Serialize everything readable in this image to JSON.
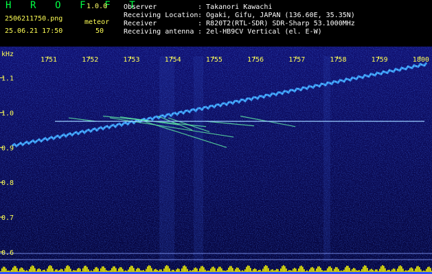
{
  "header": {
    "app_title": "H R O F F T",
    "version": "1.0.0",
    "filename": "2506211750.png",
    "datetime": "25.06.21 17:50",
    "meteor_label": "meteor",
    "meteor_count": "50",
    "info": [
      {
        "label": "Observer",
        "value": ": Takanori Kawachi"
      },
      {
        "label": "Receiving Location",
        "value": ": Ogaki, Gifu, JAPAN (136.60E, 35.35N)"
      },
      {
        "label": "Receiver",
        "value": ": R820T2(RTL-SDR) SDR-Sharp 53.1000MHz"
      },
      {
        "label": "Receiving antenna",
        "value": ": 2el-HB9CV Vertical (el. E-W)"
      }
    ]
  },
  "chart_data": {
    "type": "heatmap",
    "ylabel": "kHz",
    "x_ticks": [
      "1751",
      "1752",
      "1753",
      "1754",
      "1755",
      "1756",
      "1757",
      "1758",
      "1759",
      "1800"
    ],
    "y_ticks": [
      "1.1",
      "1.0",
      "0.9",
      "0.8",
      "0.7",
      "0.6"
    ],
    "ylim": [
      0.58,
      1.17
    ]
  },
  "colors": {
    "background": "#000000",
    "waterfall": "#0a0a55",
    "trace": "#3aa0ff",
    "meteor": "#66ffaa",
    "carrier": "#99ccff",
    "level_bar": "#ffff00",
    "tick_text": "#ffff55"
  }
}
